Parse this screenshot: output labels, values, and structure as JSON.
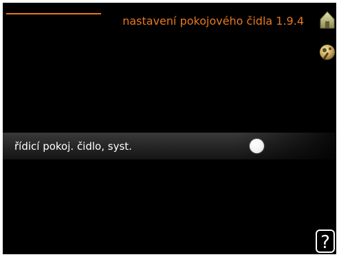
{
  "header": {
    "title": "nastavení pokojového čidla 1.9.4",
    "accent_color": "#e8781e",
    "icons": [
      "home-icon",
      "settings-icon"
    ]
  },
  "main": {
    "row_label": "řídicí pokoj. čidlo, syst.",
    "toggle_state": "off"
  },
  "footer": {
    "help_label": "?"
  }
}
